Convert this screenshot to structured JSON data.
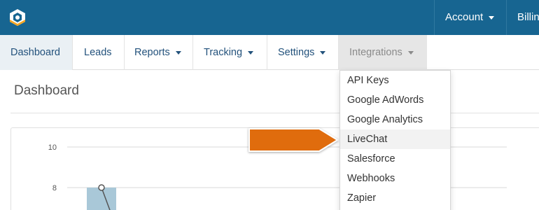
{
  "topbar": {
    "account_label": "Account",
    "billing_label": "Billing"
  },
  "nav": {
    "items": [
      {
        "label": "Dashboard"
      },
      {
        "label": "Leads"
      },
      {
        "label": "Reports"
      },
      {
        "label": "Tracking"
      },
      {
        "label": "Settings"
      },
      {
        "label": "Integrations"
      }
    ]
  },
  "page": {
    "title": "Dashboard"
  },
  "integrations_menu": {
    "items": [
      {
        "label": "API Keys"
      },
      {
        "label": "Google AdWords"
      },
      {
        "label": "Google Analytics"
      },
      {
        "label": "LiveChat"
      },
      {
        "label": "Salesforce"
      },
      {
        "label": "Webhooks"
      },
      {
        "label": "Zapier"
      }
    ],
    "highlighted": "LiveChat"
  },
  "colors": {
    "topbar": "#176591",
    "accent_arrow": "#e06c0f",
    "bar": "#a9c8d8"
  },
  "chart_data": {
    "type": "bar",
    "y_ticks": [
      10,
      8
    ],
    "bar_value": 8,
    "line_start_value": 8,
    "grid": true
  }
}
